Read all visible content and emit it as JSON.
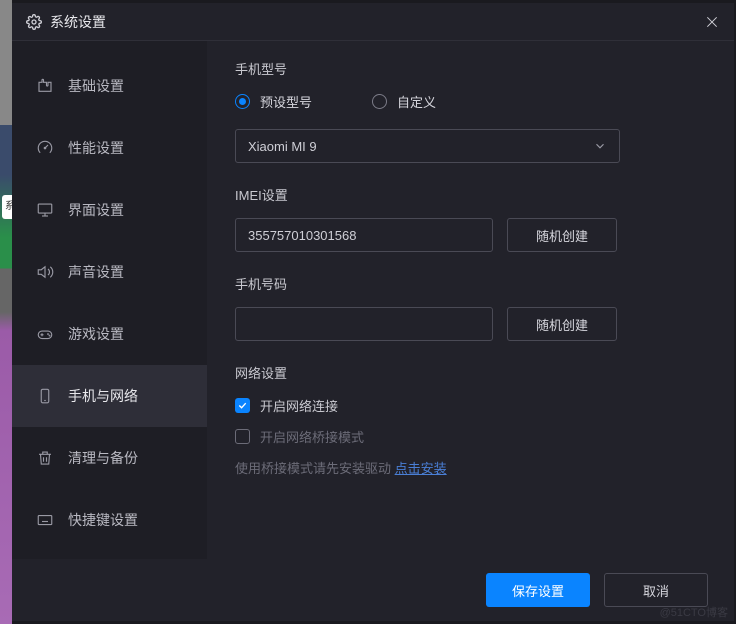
{
  "titlebar": {
    "title": "系统设置"
  },
  "sidebar": {
    "items": [
      {
        "label": "基础设置"
      },
      {
        "label": "性能设置"
      },
      {
        "label": "界面设置"
      },
      {
        "label": "声音设置"
      },
      {
        "label": "游戏设置"
      },
      {
        "label": "手机与网络"
      },
      {
        "label": "清理与备份"
      },
      {
        "label": "快捷键设置"
      }
    ],
    "active_index": 5
  },
  "content": {
    "phone_model": {
      "label": "手机型号",
      "radio_preset": "预设型号",
      "radio_custom": "自定义",
      "selected": "preset",
      "value": "Xiaomi MI 9"
    },
    "imei": {
      "label": "IMEI设置",
      "value": "355757010301568",
      "random_btn": "随机创建"
    },
    "phone_number": {
      "label": "手机号码",
      "value": "",
      "random_btn": "随机创建"
    },
    "network": {
      "label": "网络设置",
      "enable_network": "开启网络连接",
      "enable_network_checked": true,
      "enable_bridge": "开启网络桥接模式",
      "enable_bridge_checked": false,
      "bridge_hint_prefix": "使用桥接模式请先安装驱动 ",
      "bridge_hint_link": "点击安装"
    }
  },
  "footer": {
    "save": "保存设置",
    "cancel": "取消"
  },
  "watermark": "@51CTO博客",
  "strip_label": "系"
}
